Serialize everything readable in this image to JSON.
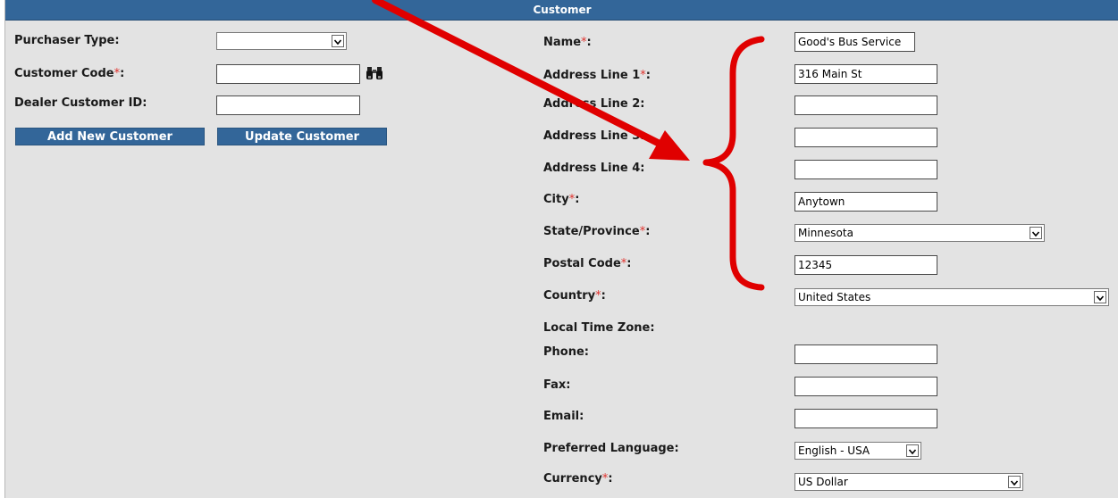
{
  "header": {
    "title": "Customer"
  },
  "required_mark": "*",
  "left": {
    "purchaser_type": {
      "label": "Purchaser Type:",
      "value": ""
    },
    "customer_code": {
      "label": "Customer Code",
      "label_suffix": ":",
      "value": ""
    },
    "dealer_customer_id": {
      "label": "Dealer Customer ID:",
      "value": ""
    },
    "add_button": "Add New Customer",
    "update_button": "Update Customer"
  },
  "right": {
    "name": {
      "label": "Name",
      "label_suffix": ":",
      "value": "Good's Bus Service"
    },
    "address1": {
      "label": "Address Line 1",
      "label_suffix": ":",
      "value": "316 Main St"
    },
    "address2": {
      "label": "Address Line 2:",
      "value": ""
    },
    "address3": {
      "label": "Address Line 3:",
      "value": ""
    },
    "address4": {
      "label": "Address Line 4:",
      "value": ""
    },
    "city": {
      "label": "City",
      "label_suffix": ":",
      "value": "Anytown"
    },
    "state": {
      "label": "State/Province",
      "label_suffix": ":",
      "value": "Minnesota"
    },
    "postal": {
      "label": "Postal Code",
      "label_suffix": ":",
      "value": "12345"
    },
    "country": {
      "label": "Country",
      "label_suffix": ":",
      "value": "United States"
    },
    "timezone": {
      "label": "Local Time Zone:"
    },
    "phone": {
      "label": "Phone:",
      "value": ""
    },
    "fax": {
      "label": "Fax:",
      "value": ""
    },
    "email": {
      "label": "Email:",
      "value": ""
    },
    "language": {
      "label": "Preferred Language:",
      "value": "English - USA"
    },
    "currency": {
      "label": "Currency",
      "label_suffix": ":",
      "value": "US Dollar"
    }
  },
  "colors": {
    "header_bg": "#336699",
    "panel_bg": "#e3e3e3",
    "required": "#e0302b",
    "annotation": "#e00000"
  },
  "icons": {
    "lookup": "binoculars-icon",
    "dropdown": "chevron-down-icon",
    "annotation_arrow": "red-arrow-icon",
    "annotation_brace": "red-curly-brace-icon"
  }
}
